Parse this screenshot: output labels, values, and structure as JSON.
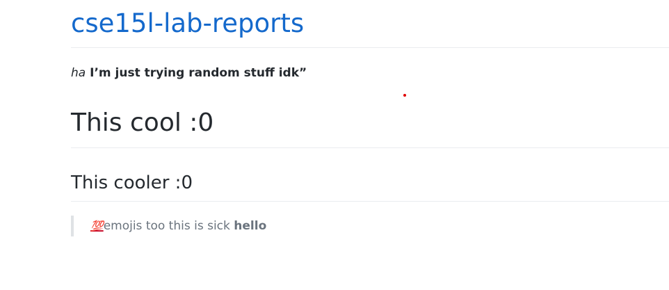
{
  "header": {
    "title": "cse15l-lab-reports"
  },
  "content": {
    "paragraph": {
      "italic": "ha",
      "bold": "I’m just trying random stuff idk”"
    },
    "heading1": "This cool :0",
    "heading2": "This cooler :0",
    "blockquote": {
      "emoji": "💯",
      "text": "emojis too this is sick",
      "bold": "hello"
    }
  }
}
